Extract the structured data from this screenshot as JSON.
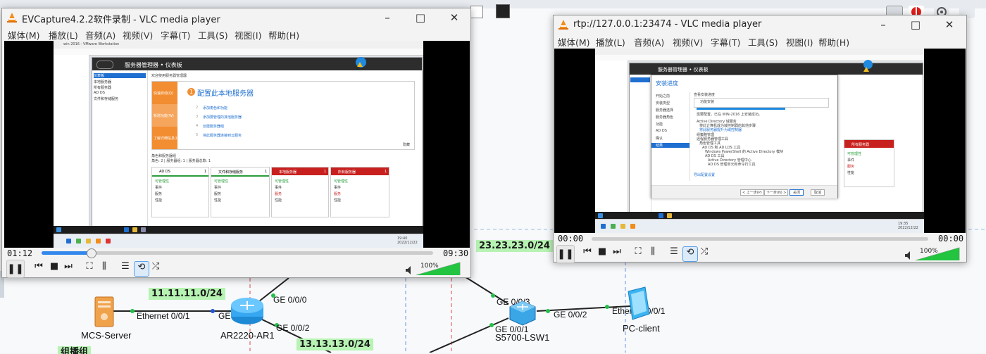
{
  "topology": {
    "networks": [
      "23.23.23.0/24",
      "11.11.11.0/24",
      "13.13.13.0/24"
    ],
    "interfaces": [
      "Ethernet 0/0/1",
      "GE 0/0/1",
      "GE 0/0/0",
      "GE 0/0/2",
      "GE 0/0/3",
      "GE 0/0/1",
      "GE 0/0/2",
      "Ethernet 0/0/1"
    ],
    "devices": [
      "MCS-Server",
      "AR2220-AR1",
      "S5700-LSW1",
      "PC-client"
    ],
    "partial_label": "组播组"
  },
  "vlc_left": {
    "title": "EVCapture4.2.2软件录制 - VLC media player",
    "menu": [
      "媒体(M)",
      "播放(L)",
      "音频(A)",
      "视频(V)",
      "字幕(T)",
      "工具(S)",
      "视图(I)",
      "帮助(H)"
    ],
    "time_elapsed": "01:12",
    "time_total": "09:30",
    "progress": 0.126,
    "volume": "100%",
    "video": {
      "vm_title": "win 2016 - VMware Workstation",
      "sm_title": "服务器管理器 • 仪表板",
      "nav": [
        "仪表板",
        "本地服务器",
        "所有服务器",
        "AD DS",
        "文件和存储服务"
      ],
      "welcome": "欢迎使用服务器管理器",
      "quick_start_title": "配置此本地服务器",
      "quick_start_number": "1",
      "quick_start_steps": [
        {
          "n": "2",
          "text": "添加角色和功能"
        },
        {
          "n": "3",
          "text": "添加要管理的其他服务器"
        },
        {
          "n": "4",
          "text": "创建服务器组"
        },
        {
          "n": "5",
          "text": "将此服务器连接到云服务"
        }
      ],
      "side_labels": [
        "快速启动(Q)",
        "新增功能(W)",
        "了解详细信息(L)"
      ],
      "hide": "隐藏",
      "roles_title": "角色和服务器组",
      "roles_sub": "角色: 2 | 服务器组: 1 | 服务器总数: 1",
      "tiles": [
        {
          "name": "AD DS",
          "count": "1",
          "rows": [
            "可管理性",
            "事件",
            "服务",
            "性能"
          ]
        },
        {
          "name": "文件和存储服务",
          "count": "1",
          "rows": [
            "可管理性",
            "事件",
            "服务",
            "性能"
          ]
        },
        {
          "name": "本地服务器",
          "count": "1",
          "rows": [
            "可管理性",
            "事件",
            "服务",
            "性能"
          ]
        },
        {
          "name": "所有服务器",
          "count": "1",
          "rows": [
            "可管理性",
            "事件",
            "服务",
            "性能"
          ]
        }
      ],
      "tile_badge": "1",
      "clock": "19:40\n2022/12/22"
    }
  },
  "vlc_right": {
    "title": "rtp://127.0.0.1:23474 - VLC media player",
    "menu": [
      "媒体(M)",
      "播放(L)",
      "音频(A)",
      "视频(V)",
      "字幕(T)",
      "工具(S)",
      "视图(I)",
      "帮助(H)"
    ],
    "time_elapsed": "00:00",
    "time_total": "00:00",
    "progress": 0,
    "volume": "100%",
    "video": {
      "sm_title": "服务器管理器 • 仪表板",
      "dialog_title": "安装进度",
      "dialog_nav": [
        "开始之前",
        "安装类型",
        "服务器选择",
        "服务器角色",
        "功能",
        "AD DS",
        "确认",
        "结果"
      ],
      "dialog_lines": [
        "查看安装进度",
        "功能安装",
        "需要配置。已在 WIN-2016 上安装成功。",
        "Active Directory 域服务",
        "使此计算机成为域控制器的其他步骤",
        "将此服务器提升为域控制器",
        "组策略管理",
        "远程服务器管理工具",
        "角色管理工具",
        "AD DS 和 AD LDS 工具",
        "Windows PowerShell 的 Active Directory 模块",
        "AD DS 工具",
        "Active Directory 管理中心",
        "AD DS 管理单元和命令行工具",
        "导出配置设置"
      ],
      "dialog_buttons": [
        "< 上一步(P)",
        "下一步(N) >",
        "关闭",
        "取消"
      ],
      "tile_name": "所有服务器",
      "tile_rows": [
        "可管理性",
        "事件",
        "服务",
        "性能"
      ],
      "clock": "19:35\n2022/12/22"
    }
  },
  "colors": {
    "net_label_bg": "#b7f3b3",
    "vlc_orange": "#f28c1a",
    "seek_fill": "#3388ee",
    "sm_orange": "#f28d31",
    "tile_red": "#c8201e"
  }
}
